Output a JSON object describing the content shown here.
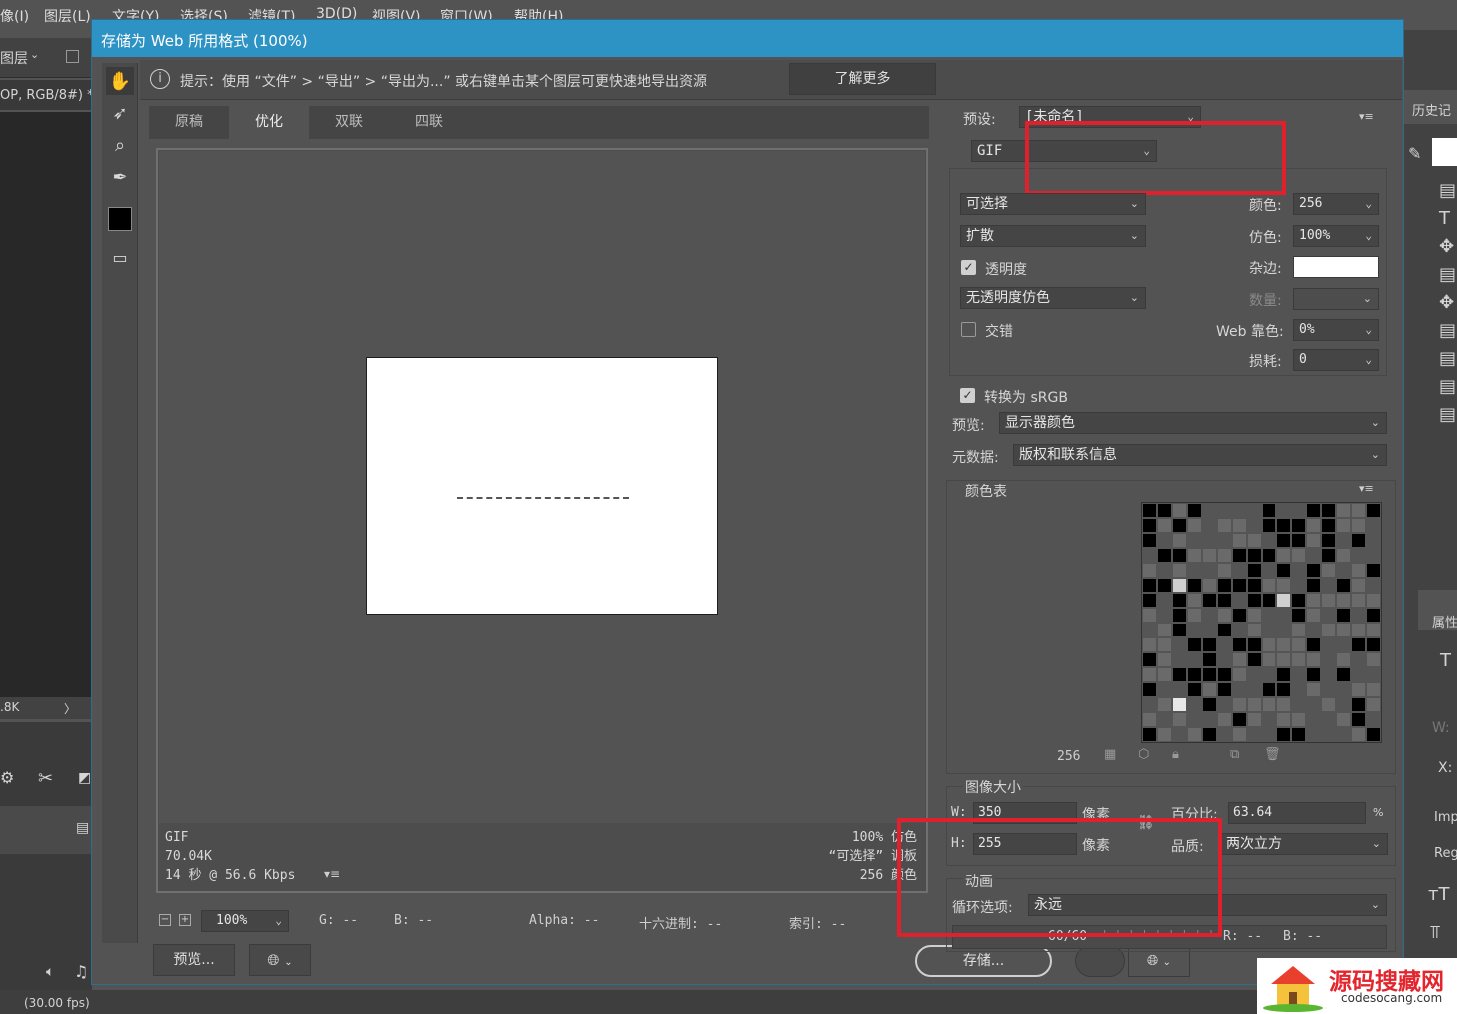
{
  "menubar": {
    "items": [
      "像(I)",
      "图层(L)",
      "文字(Y)",
      "选择(S)",
      "滤镜(T)",
      "3D(D)",
      "视图(V)",
      "窗口(W)",
      "帮助(H)"
    ]
  },
  "ps_bg": {
    "layer_dropdown": "图层",
    "doc_tab": "OP, RGB/8#) *",
    "status": ".8K",
    "timeline_fps": "(30.00 fps)",
    "right_header": "历史记",
    "props_header": "属性"
  },
  "dialog": {
    "title": "存储为 Web 所用格式 (100%)",
    "hint": "提示：使用 “文件” > “导出” > “导出为...” 或右键单击某个图层可更快速地导出资源",
    "learn_more": "了解更多",
    "tabs": [
      "原稿",
      "优化",
      "双联",
      "四联"
    ],
    "active_tab": "优化",
    "info_left": [
      "GIF",
      "70.04K",
      "14 秒 @ 56.6 Kbps"
    ],
    "info_right": [
      "100% 仿色",
      "“可选择” 调板",
      "256 颜色"
    ],
    "zoom": "100%",
    "readout": {
      "g": "G: --",
      "b": "B: --",
      "alpha": "Alpha: --",
      "hex": "十六进制: --",
      "index": "索引: --"
    },
    "preview_btn": "预览...",
    "save_btn": "存储...",
    "preset_label": "预设:",
    "preset_value": "[未命名]",
    "format": "GIF",
    "reduction": "可选择",
    "dither_algo": "扩散",
    "transparency_label": "透明度",
    "transparency_dither": "无透明度仿色",
    "interlaced_label": "交错",
    "colors_label": "颜色:",
    "colors_value": "256",
    "dither_label": "仿色:",
    "dither_value": "100%",
    "matte_label": "杂边:",
    "amount_label": "数量:",
    "websnap_label": "Web 靠色:",
    "websnap_value": "0%",
    "lossy_label": "损耗:",
    "lossy_value": "0",
    "srgb_label": "转换为 sRGB",
    "preview_label": "预览:",
    "preview_value": "显示器颜色",
    "metadata_label": "元数据:",
    "metadata_value": "版权和联系信息",
    "colortable_label": "颜色表",
    "colortable_count": "256",
    "imagesize_label": "图像大小",
    "w_label": "W:",
    "w_value": "350",
    "h_label": "H:",
    "h_value": "255",
    "px_label": "像素",
    "percent_label": "百分比:",
    "percent_value": "63.64",
    "percent_unit": "%",
    "quality_label": "品质:",
    "quality_value": "两次立方",
    "anim_label": "动画",
    "loop_label": "循环选项:",
    "loop_value": "永远",
    "frame_counter": "60/60",
    "r_readout": "R: --",
    "b_readout": "B: --"
  },
  "logo": {
    "main": "源码搜藏网",
    "sub": "codesocang.com"
  },
  "colors": {
    "title_blue": "#2d92c4",
    "highlight_red": "#e0202c"
  }
}
